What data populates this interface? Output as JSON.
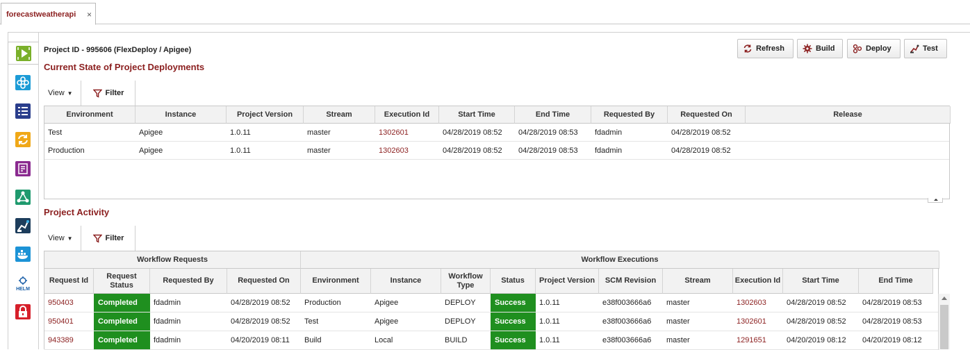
{
  "tab": {
    "label": "forecastweatherapi",
    "close": "×"
  },
  "project": {
    "heading": "Project ID - 995606 (FlexDeploy / Apigee)"
  },
  "deployments": {
    "title": "Current State of Project Deployments",
    "view_label": "View",
    "filter_label": "Filter",
    "columns": [
      "Environment",
      "Instance",
      "Project Version",
      "Stream",
      "Execution Id",
      "Start Time",
      "End Time",
      "Requested By",
      "Requested On",
      "Release"
    ],
    "rows": [
      [
        "Test",
        "Apigee",
        "1.0.11",
        "master",
        "1302601",
        "04/28/2019 08:52",
        "04/28/2019 08:53",
        "fdadmin",
        "04/28/2019 08:52",
        ""
      ],
      [
        "Production",
        "Apigee",
        "1.0.11",
        "master",
        "1302603",
        "04/28/2019 08:52",
        "04/28/2019 08:53",
        "fdadmin",
        "04/28/2019 08:52",
        ""
      ]
    ]
  },
  "toolbar": {
    "refresh": "Refresh",
    "build": "Build",
    "deploy": "Deploy",
    "test": "Test"
  },
  "activity": {
    "title": "Project Activity",
    "view_label": "View",
    "filter_label": "Filter",
    "group_requests": "Workflow Requests",
    "group_executions": "Workflow Executions",
    "columns": [
      "Request Id",
      "Request Status",
      "Requested By",
      "Requested On",
      "Environment",
      "Instance",
      "Workflow Type",
      "Status",
      "Project Version",
      "SCM Revision",
      "Stream",
      "Execution Id",
      "Start Time",
      "End Time"
    ],
    "rows": [
      [
        "950403",
        "Completed",
        "fdadmin",
        "04/28/2019 08:52",
        "Production",
        "Apigee",
        "DEPLOY",
        "Success",
        "1.0.11",
        "e38f003666a6",
        "master",
        "1302603",
        "04/28/2019 08:52",
        "04/28/2019 08:53"
      ],
      [
        "950401",
        "Completed",
        "fdadmin",
        "04/28/2019 08:52",
        "Test",
        "Apigee",
        "DEPLOY",
        "Success",
        "1.0.11",
        "e38f003666a6",
        "master",
        "1302601",
        "04/28/2019 08:52",
        "04/28/2019 08:53"
      ],
      [
        "943389",
        "Completed",
        "fdadmin",
        "04/20/2019 08:11",
        "Build",
        "Local",
        "BUILD",
        "Success",
        "1.0.11",
        "e38f003666a6",
        "master",
        "1291651",
        "04/20/2019 08:12",
        "04/20/2019 08:12"
      ]
    ]
  },
  "sidebar": {
    "icons": [
      "execute-icon",
      "integration-icon",
      "checklist-icon",
      "sync-icon",
      "report-icon",
      "workflow-icon",
      "robot-icon",
      "docker-icon",
      "helm-icon",
      "lock-icon"
    ],
    "helm_label": "HELM"
  },
  "colors": {
    "accent": "#8b1f1f",
    "success": "#1f8f1f"
  }
}
